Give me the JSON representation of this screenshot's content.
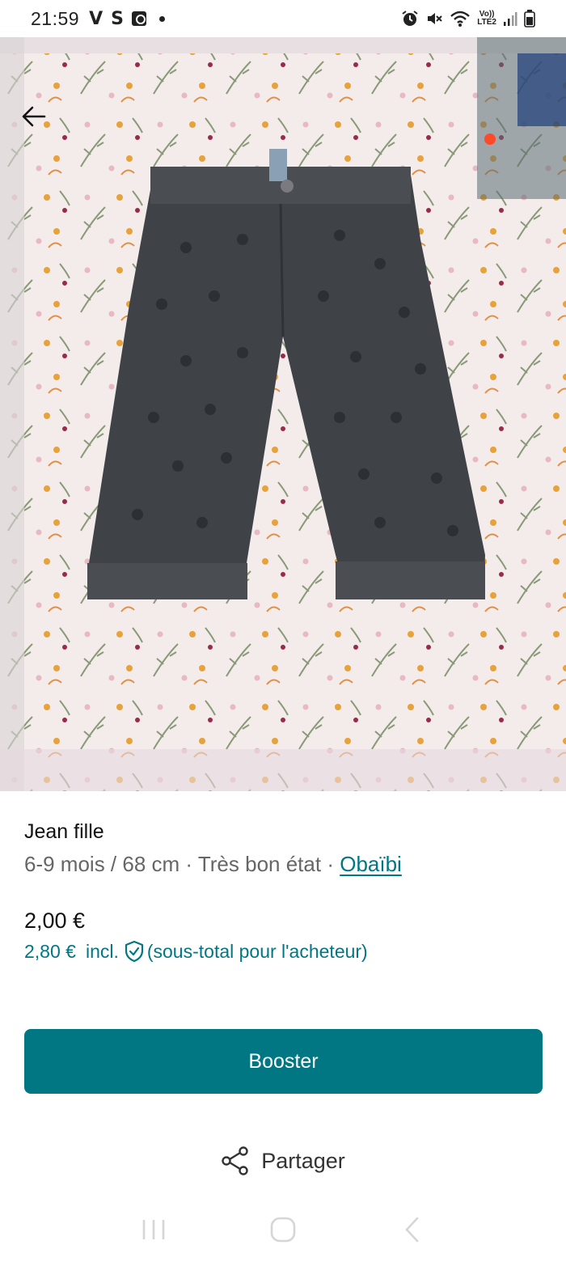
{
  "status_bar": {
    "time": "21:59",
    "left_glyphs": [
      "V",
      "S"
    ],
    "lte_top": "Vo))",
    "lte_bottom": "LTE2",
    "icons": [
      "notification-badge-icon",
      "alarm-icon",
      "mute-icon",
      "wifi-icon",
      "signal-icon",
      "battery-icon"
    ]
  },
  "photo": {
    "back_icon": "arrow-left-icon"
  },
  "item": {
    "title": "Jean fille",
    "size": "6-9 mois / 68 cm",
    "separator": "·",
    "condition": "Très bon état",
    "brand": "Obaïbi",
    "price": "2,00 €",
    "price_incl_amount": "2,80 €",
    "price_incl_label": "incl.",
    "price_incl_note": "(sous-total pour l'acheteur)"
  },
  "actions": {
    "booster_label": "Booster",
    "share_label": "Partager"
  },
  "colors": {
    "accent": "#007782",
    "text_primary": "#111111",
    "text_secondary": "#666666"
  }
}
